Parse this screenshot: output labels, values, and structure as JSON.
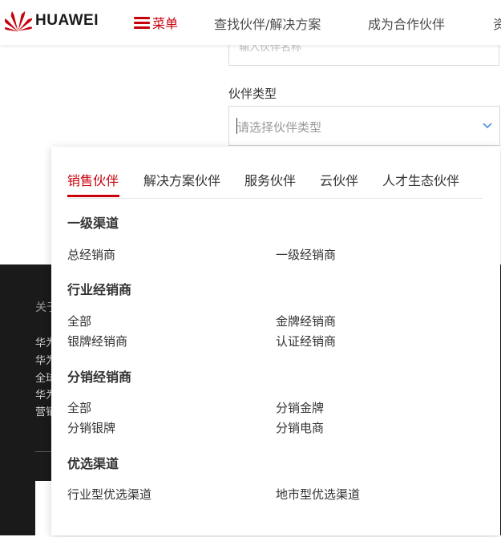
{
  "header": {
    "brand": "HUAWEI",
    "menu_label": "菜单",
    "nav": [
      "查找伙伴/解决方案",
      "成为合作伙伴",
      "资"
    ]
  },
  "form": {
    "prev_input_ghost": "输入伙伴名称",
    "partner_type_label": "伙伴类型",
    "partner_type_placeholder": "请选择伙伴类型"
  },
  "footer": {
    "heading": "关于",
    "links": [
      "华为",
      "华为",
      "全球",
      "华为",
      "营销"
    ]
  },
  "dropdown": {
    "tabs": [
      "销售伙伴",
      "解决方案伙伴",
      "服务伙伴",
      "云伙伴",
      "人才生态伙伴"
    ],
    "active_tab": "销售伙伴",
    "groups": [
      {
        "title": "一级渠道",
        "options": [
          "总经销商",
          "一级经销商"
        ]
      },
      {
        "title": "行业经销商",
        "options": [
          "全部",
          "金牌经销商",
          "银牌经销商",
          "认证经销商"
        ]
      },
      {
        "title": "分销经销商",
        "options": [
          "全部",
          "分销金牌",
          "分销银牌",
          "分销电商"
        ]
      },
      {
        "title": "优选渠道",
        "options": [
          "行业型优选渠道",
          "地市型优选渠道"
        ]
      }
    ]
  },
  "colors": {
    "brand_red": "#c7000b",
    "footer_bg": "#1a1a1a"
  }
}
